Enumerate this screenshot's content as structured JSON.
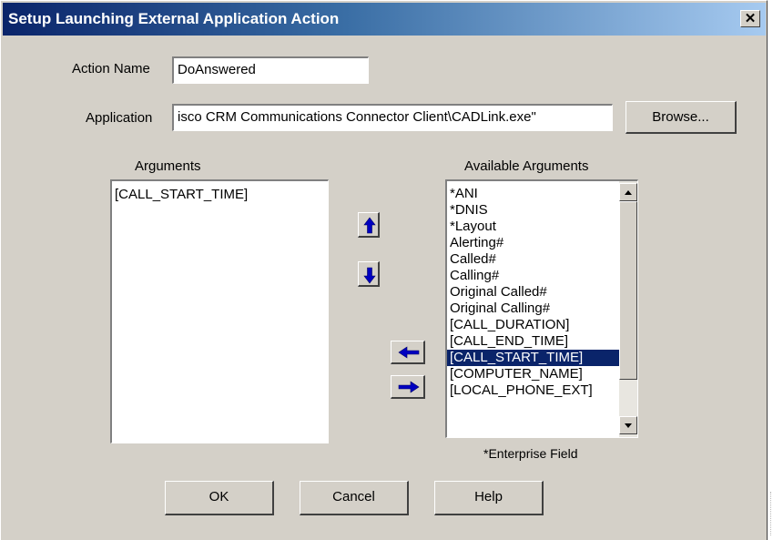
{
  "window": {
    "title": "Setup Launching External Application Action",
    "close_label": "✕"
  },
  "form": {
    "action_name_label": "Action Name",
    "action_name_value": "DoAnswered",
    "application_label": "Application",
    "application_value": "isco CRM Communications Connector Client\\CADLink.exe\"",
    "browse_label": "Browse..."
  },
  "arguments": {
    "label": "Arguments",
    "items": [
      "[CALL_START_TIME]"
    ]
  },
  "available_arguments": {
    "label": "Available Arguments",
    "items": [
      "*ANI",
      "*DNIS",
      "*Layout",
      "Alerting#",
      "Called#",
      "Calling#",
      "Original Called#",
      "Original Calling#",
      "[CALL_DURATION]",
      "[CALL_END_TIME]",
      "[CALL_START_TIME]",
      "[COMPUTER_NAME]",
      "[LOCAL_PHONE_EXT]"
    ],
    "selected": "[CALL_START_TIME]",
    "note": "*Enterprise Field"
  },
  "buttons": {
    "ok": "OK",
    "cancel": "Cancel",
    "help": "Help"
  },
  "colors": {
    "arrow": "#0000c0",
    "selection": "#0a246a",
    "titlebar": "#0a246a"
  },
  "icons": {
    "move_up": "arrow-up-icon",
    "move_down": "arrow-down-icon",
    "remove": "arrow-left-icon",
    "add": "arrow-right-icon"
  }
}
